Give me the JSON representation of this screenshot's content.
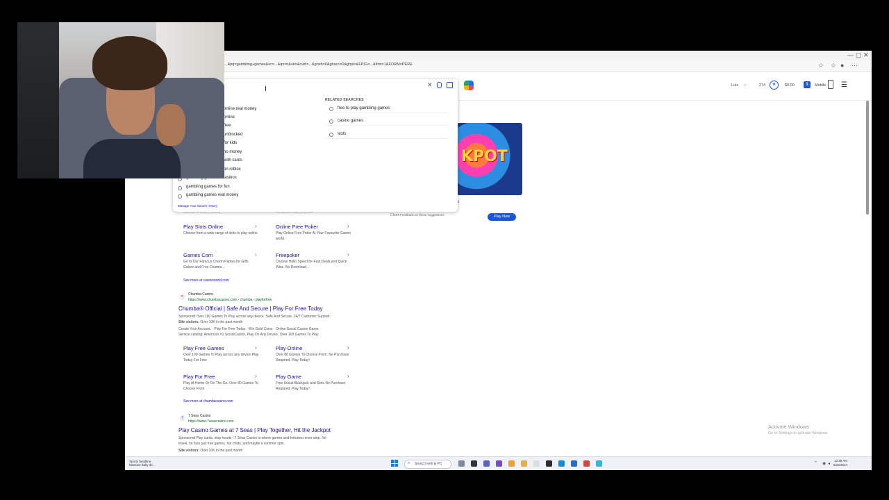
{
  "browser": {
    "url": "...&pq=gambling+games&sc=...&qs=n&sk=&cvid=...&ghsh=0&ghacc=0&ghpl=&FPIG=...&first=1&FORM=PERE",
    "window_controls": [
      "—",
      "▢",
      "✕"
    ]
  },
  "header": {
    "user_name": "Luis",
    "points": "274",
    "wallet": "$0.00",
    "mobile_label": "Mobile"
  },
  "dropdown": {
    "suggestions": [
      "online real money",
      "online",
      "free",
      "unblocked",
      "for kids",
      "no money",
      "with cards",
      "on roblox",
      "gambling games at casinos",
      "gambling games for fun",
      "gambling games real money"
    ],
    "manage_history": "Manage Your Search History",
    "related_title": "RELATED SEARCHES",
    "related": [
      "free to play gambling games",
      "casino games",
      "slots"
    ]
  },
  "results": {
    "cut_line_left": "Games At Casino World",
    "cut_line_right": "Windows, Mac, 2 Similar",
    "sitelinks_1": [
      {
        "title": "Play Slots Online",
        "desc": "Choose from a wide range of slots to play online"
      },
      {
        "title": "Online Free Poker",
        "desc": "Play Online Free Poker At Your Favourite Casino world"
      },
      {
        "title": "Games Com",
        "desc": "Go to Our Famous Charm Parties for Gifts Galore and Free Charms..."
      },
      {
        "title": "Freepoker",
        "desc": "Choose Hallo Speed for Fast Deals and Quick Wins. No Download..."
      }
    ],
    "see_more_1": "See more at casinoworld.com",
    "result2": {
      "site": "Chumba Casino",
      "url": "https://www.chumbacasino.com › chumba › playforfree",
      "title": "Chumba® Official | Safe And Secure | Play For Free Today",
      "desc1": "Sponsored Over 100 Games To Play across any device. Safe And Secure. 24/7 Customer Support.",
      "visitors_label": "Site visitors:",
      "visitors": "Over 10K in the past month",
      "desc2": "Create Your Account. · Play For Free Today · Win Gold Coins · Online Social Casino Game.",
      "desc3": "Service catalog: America's #1 SocialCasino, Play On Any Device, Over 100 Games To Play"
    },
    "sitelinks_2": [
      {
        "title": "Play Free Games",
        "desc": "Over 100 Games To Play across any device Play Today For Free"
      },
      {
        "title": "Play Online",
        "desc": "Over 80 Games To Choose From. No Purchase Required, Play Today!"
      },
      {
        "title": "Play For Free",
        "desc": "Play At Home Or On The Go. Over 80 Games To Choose From"
      },
      {
        "title": "Play Game",
        "desc": "Free Social Blackjack and Slots No Purchase Required, Play Today!"
      }
    ],
    "see_more_2": "See more at chumbacasino.com",
    "result3": {
      "site": "7 Seas Casino",
      "url": "https://www.7seascasino.com",
      "title": "Play Casino Games at 7 Seas | Play Together, Hit the Jackpot",
      "desc1": "Sponsored Play cards, stop hearts / 7 Seas Casino is where games and fortunes never stop. No",
      "desc2": "travel, no fuss just free games, fun chats, and maybe a summer spin.",
      "visitors_label": "Site visitors:",
      "visitors": "Over 10K in the past month"
    }
  },
  "ad": {
    "image_text": "KPOT",
    "overlay_letter": "s",
    "feedback": "Feedback on these suggestions",
    "cut_text": "Chum",
    "play_now": "Play Now"
  },
  "activate": {
    "title": "Activate Windows",
    "subtitle": "Go to Settings to activate Windows."
  },
  "taskbar": {
    "news_title": "Sports headline",
    "news_sub": "Massive Bully de...",
    "search_placeholder": "Search web & PC",
    "time": "12:38 AM",
    "date": "8/15/2024"
  }
}
